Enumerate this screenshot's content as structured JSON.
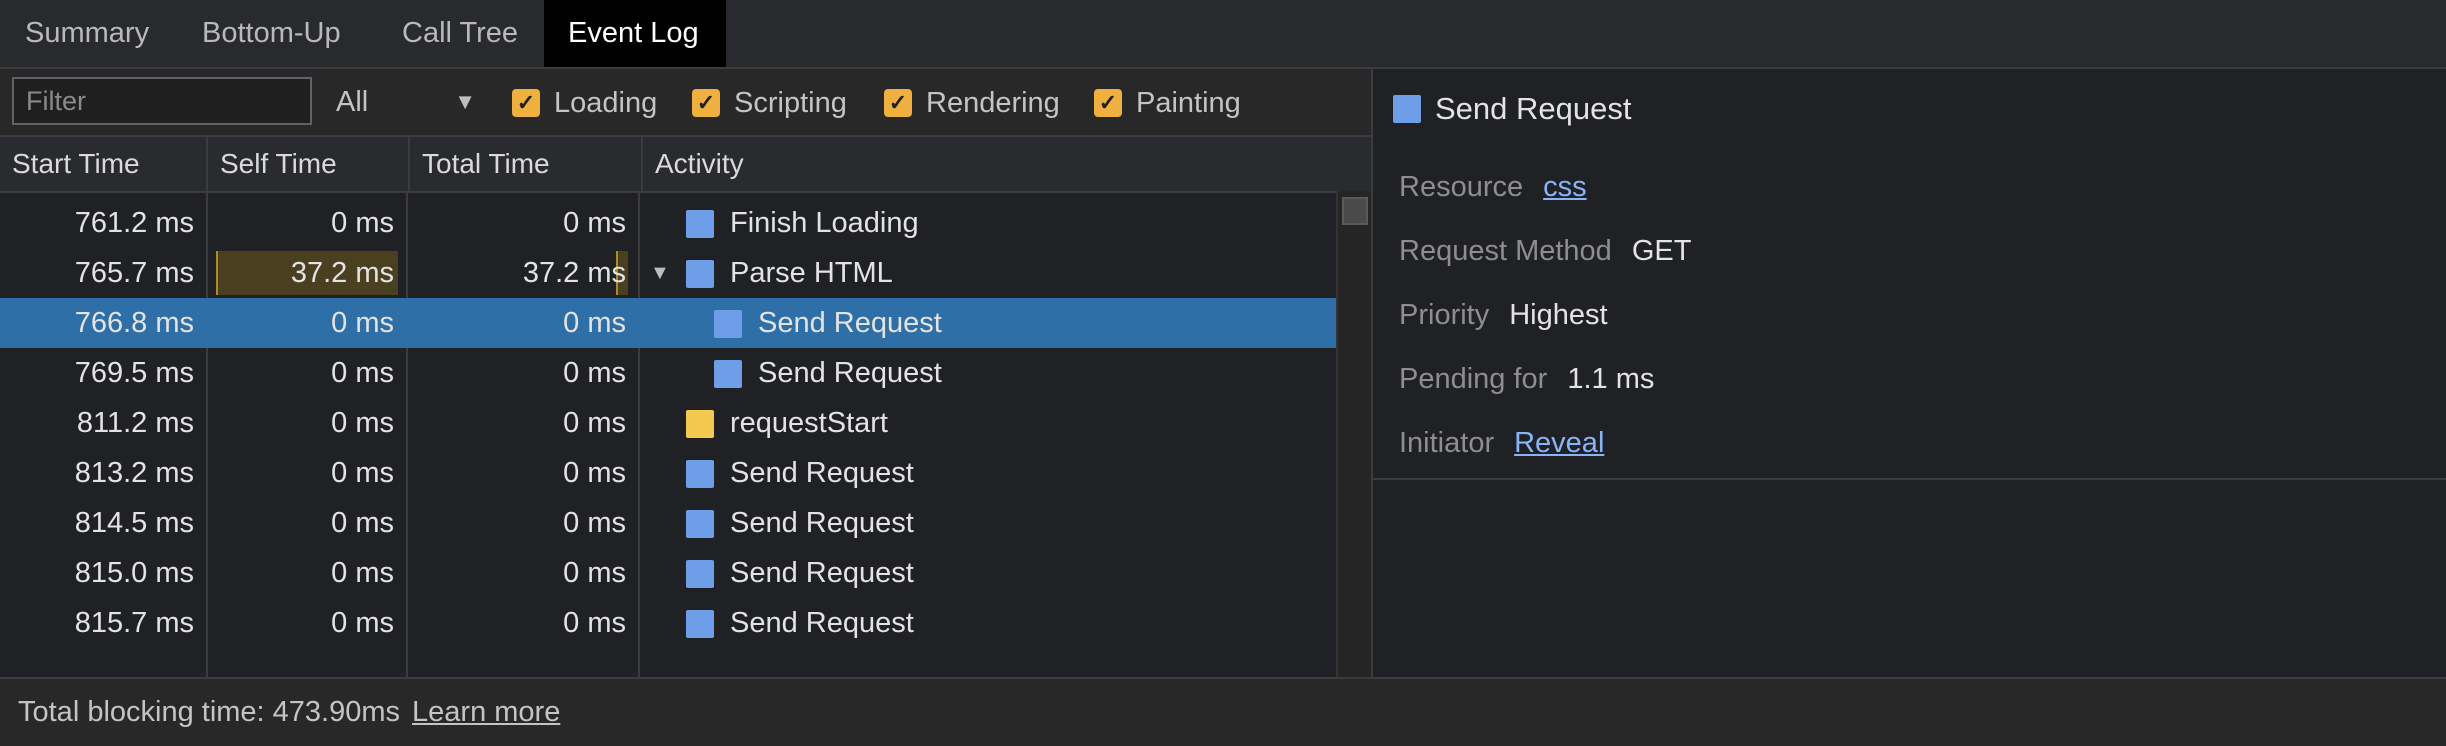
{
  "tabs": [
    "Summary",
    "Bottom-Up",
    "Call Tree",
    "Event Log"
  ],
  "active_tab": "Event Log",
  "toolbar": {
    "filter_placeholder": "Filter",
    "level": "All",
    "checkboxes": [
      {
        "label": "Loading",
        "checked": true
      },
      {
        "label": "Scripting",
        "checked": true
      },
      {
        "label": "Rendering",
        "checked": true
      },
      {
        "label": "Painting",
        "checked": true
      }
    ]
  },
  "table": {
    "headers": [
      "Start Time",
      "Self Time",
      "Total Time",
      "Activity"
    ],
    "rows": [
      {
        "start": "761.2 ms",
        "self": "0 ms",
        "total": "0 ms",
        "activity": "Finish Loading",
        "color": "#6f9ee8",
        "indent": 0
      },
      {
        "start": "765.7 ms",
        "self": "37.2 ms",
        "total": "37.2 ms",
        "activity": "Parse HTML",
        "color": "#6f9ee8",
        "indent": 0,
        "expanded": true
      },
      {
        "start": "766.8 ms",
        "self": "0 ms",
        "total": "0 ms",
        "activity": "Send Request",
        "color": "#6f9ee8",
        "indent": 1,
        "selected": true
      },
      {
        "start": "769.5 ms",
        "self": "0 ms",
        "total": "0 ms",
        "activity": "Send Request",
        "color": "#6f9ee8",
        "indent": 1
      },
      {
        "start": "811.2 ms",
        "self": "0 ms",
        "total": "0 ms",
        "activity": "requestStart",
        "color": "#f2c94c",
        "indent": 0
      },
      {
        "start": "813.2 ms",
        "self": "0 ms",
        "total": "0 ms",
        "activity": "Send Request",
        "color": "#6f9ee8",
        "indent": 0
      },
      {
        "start": "814.5 ms",
        "self": "0 ms",
        "total": "0 ms",
        "activity": "Send Request",
        "color": "#6f9ee8",
        "indent": 0
      },
      {
        "start": "815.0 ms",
        "self": "0 ms",
        "total": "0 ms",
        "activity": "Send Request",
        "color": "#6f9ee8",
        "indent": 0
      },
      {
        "start": "815.7 ms",
        "self": "0 ms",
        "total": "0 ms",
        "activity": "Send Request",
        "color": "#6f9ee8",
        "indent": 0
      }
    ]
  },
  "details": {
    "title": "Send Request",
    "title_color": "#6f9ee8",
    "fields": [
      {
        "key": "Resource",
        "value": "css",
        "link": true
      },
      {
        "key": "Request Method",
        "value": "GET",
        "link": false
      },
      {
        "key": "Priority",
        "value": "Highest",
        "link": false
      },
      {
        "key": "Pending for",
        "value": "1.1 ms",
        "link": false
      },
      {
        "key": "Initiator",
        "value": "Reveal",
        "link": true
      }
    ]
  },
  "footer": {
    "text": "Total blocking time: 473.90ms",
    "link": "Learn more"
  }
}
